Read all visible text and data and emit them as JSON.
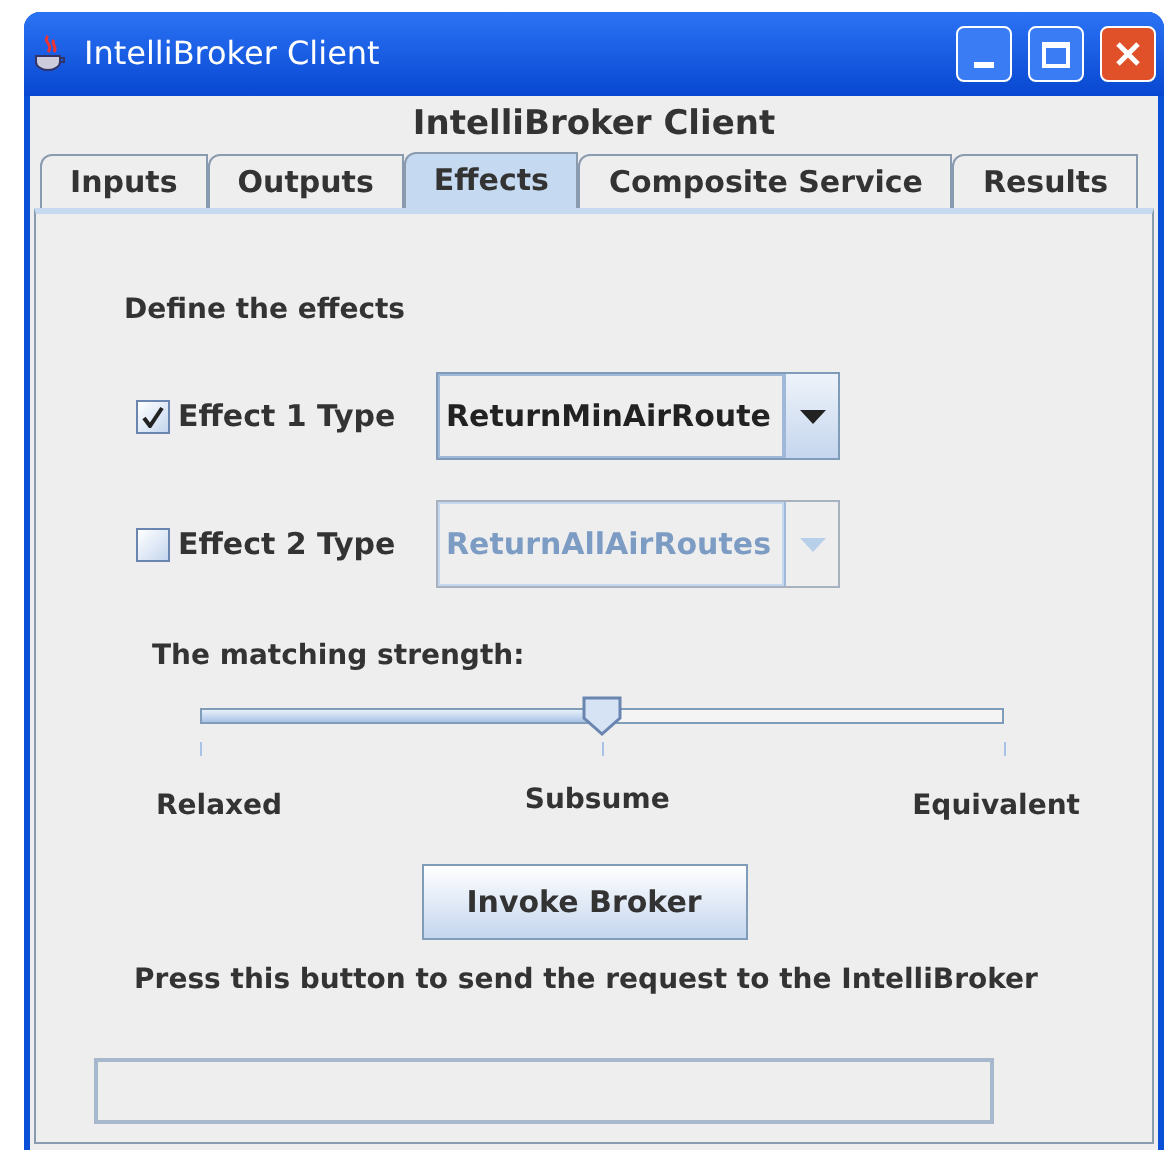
{
  "window": {
    "title": "IntelliBroker Client"
  },
  "heading": "IntelliBroker Client",
  "tabs": [
    {
      "label": "Inputs",
      "selected": false
    },
    {
      "label": "Outputs",
      "selected": false
    },
    {
      "label": "Effects",
      "selected": true
    },
    {
      "label": "Composite Service",
      "selected": false
    },
    {
      "label": "Results",
      "selected": false
    }
  ],
  "section_label": "Define the effects",
  "effects": [
    {
      "label": "Effect 1 Type",
      "checked": true,
      "value": "ReturnMinAirRoute",
      "disabled": false
    },
    {
      "label": "Effect 2 Type",
      "checked": false,
      "value": "ReturnAllAirRoutes",
      "disabled": true
    }
  ],
  "slider": {
    "label": "The matching strength:",
    "level": 0.5,
    "ticks": [
      "Relaxed",
      "Subsume",
      "Equivalent"
    ]
  },
  "button": "Invoke Broker",
  "hint": "Press this button to send the request to the IntelliBroker"
}
